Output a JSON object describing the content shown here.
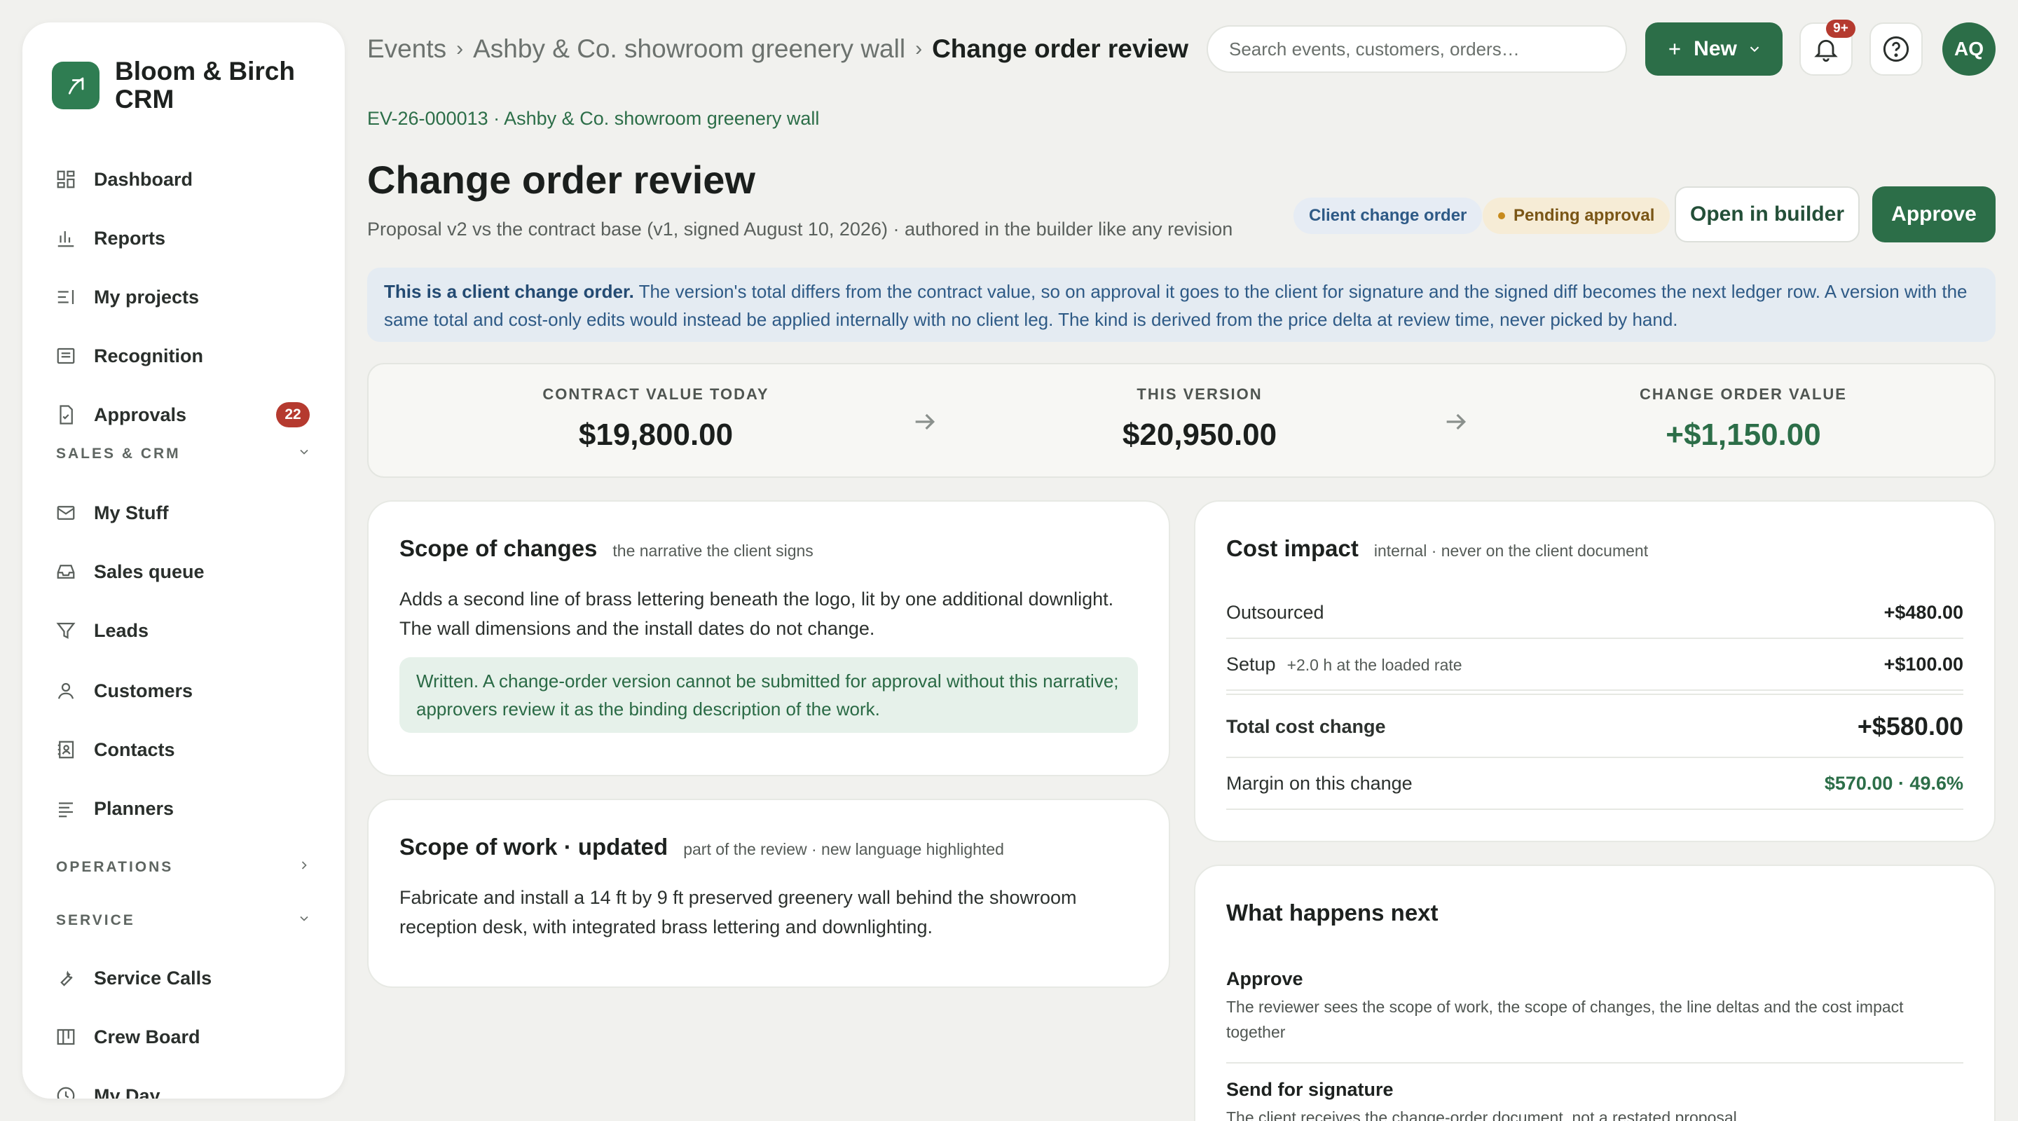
{
  "app": {
    "name": "Bloom & Birch CRM"
  },
  "sidebar": {
    "items": [
      {
        "label": "Dashboard",
        "icon": "dashboard-icon"
      },
      {
        "label": "Reports",
        "icon": "bar-chart-icon"
      },
      {
        "label": "My projects",
        "icon": "list-icon"
      },
      {
        "label": "Recognition",
        "icon": "card-icon"
      },
      {
        "label": "Approvals",
        "icon": "document-check-icon",
        "badge": "22"
      },
      {
        "label": "My Stuff",
        "icon": "mail-icon"
      },
      {
        "label": "Sales queue",
        "icon": "inbox-icon"
      },
      {
        "label": "Leads",
        "icon": "funnel-icon"
      },
      {
        "label": "Customers",
        "icon": "person-icon"
      },
      {
        "label": "Contacts",
        "icon": "contact-book-icon"
      },
      {
        "label": "Planners",
        "icon": "lines-icon"
      },
      {
        "label": "Service Calls",
        "icon": "wrench-icon"
      },
      {
        "label": "Crew Board",
        "icon": "board-icon"
      },
      {
        "label": "My Day",
        "icon": "clock-icon"
      }
    ],
    "sections": {
      "sales": "SALES & CRM",
      "operations": "OPERATIONS",
      "service": "SERVICE"
    }
  },
  "topbar": {
    "breadcrumb": [
      "Events",
      "Ashby & Co. showroom greenery wall",
      "Change order review"
    ],
    "search_placeholder": "Search events, customers, orders…",
    "new_label": "New",
    "notifications_badge": "9+",
    "avatar_initials": "AQ"
  },
  "header": {
    "event_ref": "EV-26-000013 · Ashby & Co. showroom greenery wall",
    "title": "Change order review",
    "subtitle": "Proposal v2 vs the contract base (v1, signed August 10, 2026) · authored in the builder like any revision",
    "kind_tag": "Client change order",
    "status_tag": "Pending approval",
    "open_builder_label": "Open in builder",
    "approve_label": "Approve"
  },
  "info_banner": {
    "lead": "This is a client change order.",
    "text": " The version's total differs from the contract value, so on approval it goes to the client for signature and the signed diff becomes the next ledger row. A version with the same total and cost-only edits would instead be applied internally with no client leg. The kind is derived from the price delta at review time, never picked by hand."
  },
  "totals": {
    "contract": {
      "label": "CONTRACT VALUE TODAY",
      "value": "$19,800.00"
    },
    "version": {
      "label": "THIS VERSION",
      "value": "$20,950.00"
    },
    "change": {
      "label": "CHANGE ORDER VALUE",
      "value": "+$1,150.00"
    }
  },
  "scope_changes": {
    "title": "Scope of changes",
    "subtitle": "the narrative the client signs",
    "body": "Adds a second line of brass lettering beneath the logo, lit by one additional downlight. The wall dimensions and the install dates do not change.",
    "note": "Written. A change-order version cannot be submitted for approval without this narrative; approvers review it as the binding description of the work."
  },
  "scope_work": {
    "title": "Scope of work · updated",
    "subtitle": "part of the review · new language highlighted",
    "body": "Fabricate and install a 14 ft by 9 ft preserved greenery wall behind the showroom reception desk, with integrated brass lettering and downlighting."
  },
  "cost_impact": {
    "title": "Cost impact",
    "subtitle": "internal · never on the client document",
    "rows": [
      {
        "label": "Outsourced",
        "hint": "",
        "amount": "+$480.00"
      },
      {
        "label": "Setup",
        "hint": "+2.0 h at the loaded rate",
        "amount": "+$100.00"
      }
    ],
    "total_label": "Total cost change",
    "total_amount": "+$580.00",
    "margin_label": "Margin on this change",
    "margin_value": "$570.00 · 49.6%"
  },
  "next_steps": {
    "title": "What happens next",
    "steps": [
      {
        "title": "Approve",
        "desc": "The reviewer sees the scope of work, the scope of changes, the line deltas and the cost impact together"
      },
      {
        "title": "Send for signature",
        "desc": "The client receives the change-order document, not a restated proposal"
      }
    ]
  },
  "colors": {
    "brand": "#2c6e48",
    "badge": "#b53a2f",
    "info_bg": "#e4ebf2",
    "positive": "#2c6e48"
  }
}
